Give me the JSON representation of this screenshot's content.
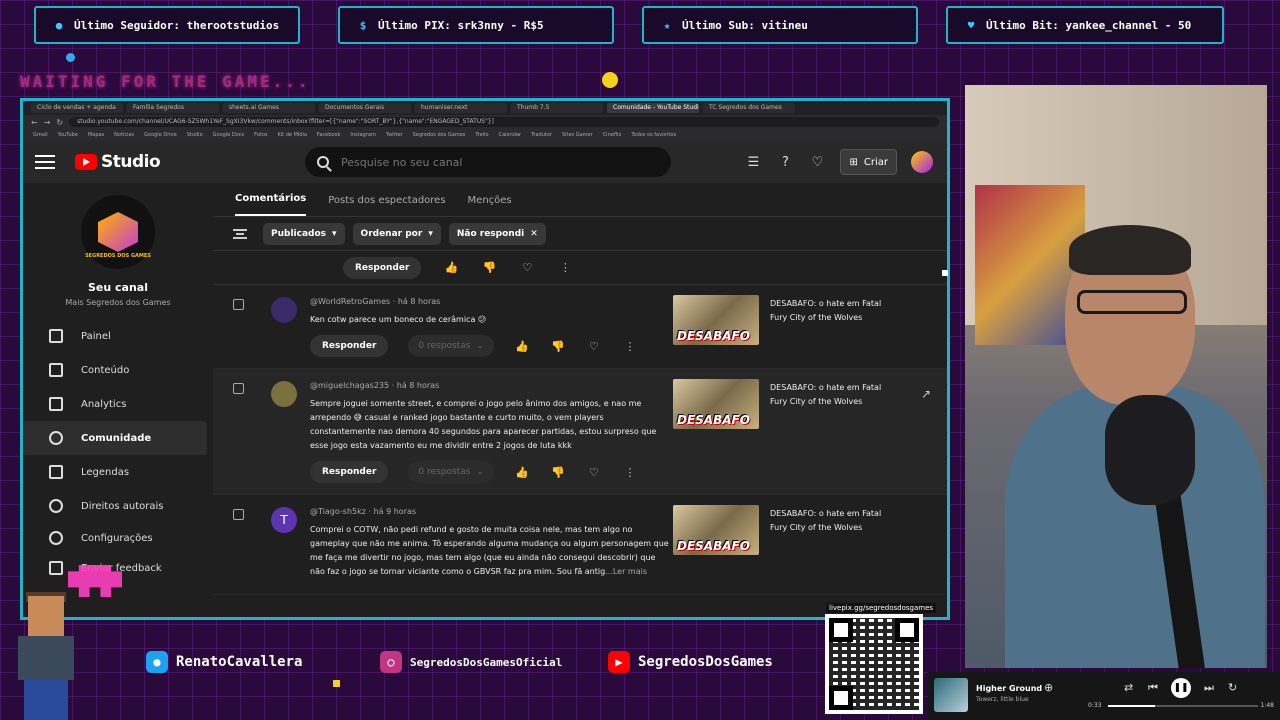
{
  "overlay": {
    "alerts": [
      {
        "label": "Último Seguidor: therootstudios",
        "icon": "user-icon"
      },
      {
        "label": "Último PIX: srk3nny - R$5",
        "icon": "dollar-icon"
      },
      {
        "label": "Último Sub: vitineu",
        "icon": "star-icon"
      },
      {
        "label": "Último Bit: yankee_channel - 50",
        "icon": "diamond-icon"
      }
    ],
    "waiting_text": "WAITING FOR THE GAME...",
    "accent_color": "#1fb4c8",
    "social": [
      {
        "label": "RenatoCavallera",
        "icon": "twitter-icon",
        "color": "#1da1f2"
      },
      {
        "label": "SegredosDosGamesOficial",
        "icon": "instagram-icon",
        "color": "#c13584"
      },
      {
        "label": "SegredosDosGames",
        "icon": "youtube-icon",
        "color": "#ff0000"
      }
    ],
    "qr_label": "livepix.gg/segredosdosgames"
  },
  "browser": {
    "tabs": [
      "Ciclo de vendas + agenda",
      "Família Segredos",
      "sheets.ai Games",
      "Documentos Gerais",
      "humaniser.next",
      "Thumb 7.5",
      "Comunidade - YouTube Studio",
      "TC Segredos dos Games"
    ],
    "url": "studio.youtube.com/channel/UCAG6-SZ5Wh1YeF_SgXI3Vkw/comments/inbox?filter=[{\"name\":\"SORT_BY\"},{\"name\":\"ENGAGED_STATUS\"}]",
    "bookmarks": [
      "Gmail",
      "YouTube",
      "Mapas",
      "Notícias",
      "Google Drive",
      "Studio",
      "Google Docs",
      "Fotos",
      "Kit de Mídia",
      "Facebook",
      "Instagram",
      "Twitter",
      "Segredos dos Games",
      "Trello",
      "Calendar",
      "Tradutor",
      "Sites Gamer",
      "Cineflix",
      "Todos os favoritos"
    ]
  },
  "studio": {
    "logo_text": "Studio",
    "search_placeholder": "Pesquise no seu canal",
    "create_label": "Criar",
    "channel": {
      "title": "Seu canal",
      "name": "Mais Segredos dos Games",
      "logo_text": "SEGREDOS DOS GAMES"
    },
    "nav": [
      {
        "label": "Painel",
        "icon": "dashboard-icon"
      },
      {
        "label": "Conteúdo",
        "icon": "content-icon"
      },
      {
        "label": "Analytics",
        "icon": "analytics-icon"
      },
      {
        "label": "Comunidade",
        "icon": "community-icon",
        "active": true
      },
      {
        "label": "Legendas",
        "icon": "subtitles-icon"
      },
      {
        "label": "Direitos autorais",
        "icon": "copyright-icon"
      },
      {
        "label": "Configurações",
        "icon": "settings-icon"
      },
      {
        "label": "Enviar feedback",
        "icon": "feedback-icon"
      }
    ],
    "tabs": [
      {
        "label": "Comentários",
        "active": true
      },
      {
        "label": "Posts dos espectadores"
      },
      {
        "label": "Menções"
      }
    ],
    "filters": [
      {
        "label": "Publicados",
        "suffix": "▾"
      },
      {
        "label": "Ordenar por",
        "suffix": "▾"
      },
      {
        "label": "Não respondi",
        "suffix": "✕"
      }
    ],
    "reply_label": "Responder",
    "replies_label": "0 respostas",
    "more_label": "...Ler mais",
    "comments": [
      {
        "author": "@WorldRetroGames",
        "time": "há 8 horas",
        "text": "Ken cotw parece um boneco de cerâmica 😕",
        "video_title": "DESABAFO: o hate em Fatal Fury City of the Wolves",
        "thumb_text": "DESABAFO",
        "avatar_color": "#3a2a6a",
        "avatar_letter": ""
      },
      {
        "author": "@miguelchagas235",
        "time": "há 8 horas",
        "text": "Sempre joguei somente street, e comprei o jogo pelo ânimo dos amigos, e nao me arrependo 😅 casual e ranked jogo bastante e curto muito, o vem players constantemente nao demora 40 segundos para aparecer partidas, estou surpreso que esse jogo esta vazamento eu me dividir entre 2 jogos de luta kkk",
        "video_title": "DESABAFO: o hate em Fatal Fury City of the Wolves",
        "thumb_text": "DESABAFO",
        "avatar_color": "#7a7040",
        "avatar_letter": ""
      },
      {
        "author": "@Tiago-sh5kz",
        "time": "há 9 horas",
        "text": "Comprei o COTW, não pedi refund e gosto de muita coisa nele, mas tem algo no gameplay que não me anima. Tô esperando alguma mudança ou algum personagem que me faça me divertir no jogo, mas tem algo (que eu ainda não consegui descobrir) que não faz o jogo se tornar viciante como o GBVSR faz pra mim. Sou fã antig",
        "video_title": "DESABAFO: o hate em Fatal Fury City of the Wolves",
        "thumb_text": "DESABAFO",
        "avatar_color": "#5e35b1",
        "avatar_letter": "T"
      }
    ]
  },
  "player": {
    "song": "Higher Ground",
    "artist": "Towerz, little blue",
    "time_current": "0:33",
    "time_total": "1:48",
    "progress": 0.31
  }
}
